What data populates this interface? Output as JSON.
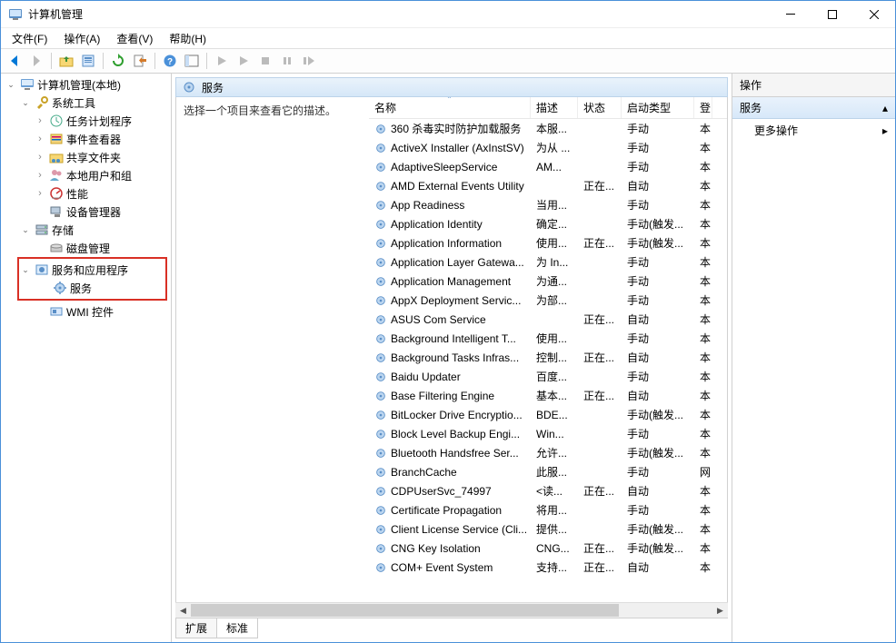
{
  "window": {
    "title": "计算机管理"
  },
  "menubar": {
    "file": "文件(F)",
    "action": "操作(A)",
    "view": "查看(V)",
    "help": "帮助(H)"
  },
  "tree": {
    "root": "计算机管理(本地)",
    "system_tools": "系统工具",
    "task_scheduler": "任务计划程序",
    "event_viewer": "事件查看器",
    "shared_folders": "共享文件夹",
    "local_users": "本地用户和组",
    "performance": "性能",
    "device_manager": "设备管理器",
    "storage": "存储",
    "disk_management": "磁盘管理",
    "services_apps": "服务和应用程序",
    "services": "服务",
    "wmi": "WMI 控件"
  },
  "svc_header": "服务",
  "svc_desc_prompt": "选择一个项目来查看它的描述。",
  "columns": {
    "name": "名称",
    "desc": "描述",
    "status": "状态",
    "startup": "启动类型",
    "logon": "登"
  },
  "services": [
    {
      "name": "360 杀毒实时防护加载服务",
      "desc": "本服...",
      "status": "",
      "startup": "手动",
      "logon": "本"
    },
    {
      "name": "ActiveX Installer (AxInstSV)",
      "desc": "为从 ...",
      "status": "",
      "startup": "手动",
      "logon": "本"
    },
    {
      "name": "AdaptiveSleepService",
      "desc": "AM...",
      "status": "",
      "startup": "手动",
      "logon": "本"
    },
    {
      "name": "AMD External Events Utility",
      "desc": "",
      "status": "正在...",
      "startup": "自动",
      "logon": "本"
    },
    {
      "name": "App Readiness",
      "desc": "当用...",
      "status": "",
      "startup": "手动",
      "logon": "本"
    },
    {
      "name": "Application Identity",
      "desc": "确定...",
      "status": "",
      "startup": "手动(触发...",
      "logon": "本"
    },
    {
      "name": "Application Information",
      "desc": "使用...",
      "status": "正在...",
      "startup": "手动(触发...",
      "logon": "本"
    },
    {
      "name": "Application Layer Gatewa...",
      "desc": "为 In...",
      "status": "",
      "startup": "手动",
      "logon": "本"
    },
    {
      "name": "Application Management",
      "desc": "为通...",
      "status": "",
      "startup": "手动",
      "logon": "本"
    },
    {
      "name": "AppX Deployment Servic...",
      "desc": "为部...",
      "status": "",
      "startup": "手动",
      "logon": "本"
    },
    {
      "name": "ASUS Com Service",
      "desc": "",
      "status": "正在...",
      "startup": "自动",
      "logon": "本"
    },
    {
      "name": "Background Intelligent T...",
      "desc": "使用...",
      "status": "",
      "startup": "手动",
      "logon": "本"
    },
    {
      "name": "Background Tasks Infras...",
      "desc": "控制...",
      "status": "正在...",
      "startup": "自动",
      "logon": "本"
    },
    {
      "name": "Baidu Updater",
      "desc": "百度...",
      "status": "",
      "startup": "手动",
      "logon": "本"
    },
    {
      "name": "Base Filtering Engine",
      "desc": "基本...",
      "status": "正在...",
      "startup": "自动",
      "logon": "本"
    },
    {
      "name": "BitLocker Drive Encryptio...",
      "desc": "BDE...",
      "status": "",
      "startup": "手动(触发...",
      "logon": "本"
    },
    {
      "name": "Block Level Backup Engi...",
      "desc": "Win...",
      "status": "",
      "startup": "手动",
      "logon": "本"
    },
    {
      "name": "Bluetooth Handsfree Ser...",
      "desc": "允许...",
      "status": "",
      "startup": "手动(触发...",
      "logon": "本"
    },
    {
      "name": "BranchCache",
      "desc": "此服...",
      "status": "",
      "startup": "手动",
      "logon": "网"
    },
    {
      "name": "CDPUserSvc_74997",
      "desc": "<读...",
      "status": "正在...",
      "startup": "自动",
      "logon": "本"
    },
    {
      "name": "Certificate Propagation",
      "desc": "将用...",
      "status": "",
      "startup": "手动",
      "logon": "本"
    },
    {
      "name": "Client License Service (Cli...",
      "desc": "提供...",
      "status": "",
      "startup": "手动(触发...",
      "logon": "本"
    },
    {
      "name": "CNG Key Isolation",
      "desc": "CNG...",
      "status": "正在...",
      "startup": "手动(触发...",
      "logon": "本"
    },
    {
      "name": "COM+ Event System",
      "desc": "支持...",
      "status": "正在...",
      "startup": "自动",
      "logon": "本"
    }
  ],
  "tabs": {
    "extended": "扩展",
    "standard": "标准"
  },
  "actions": {
    "header": "操作",
    "section": "服务",
    "more": "更多操作"
  }
}
